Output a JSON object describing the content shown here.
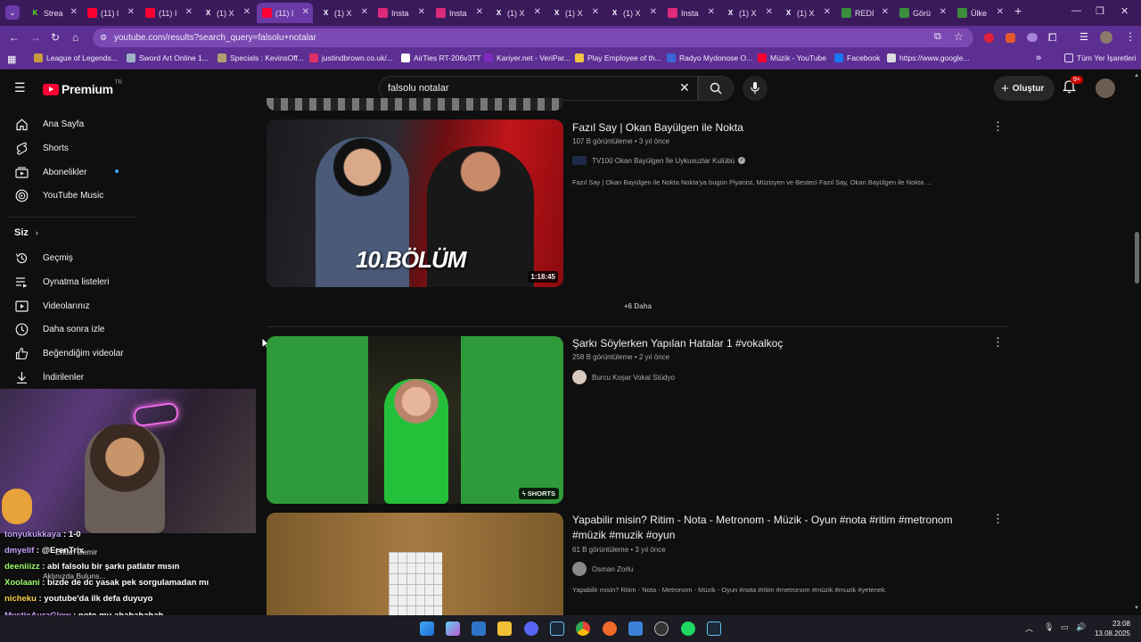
{
  "browser": {
    "tabs": [
      {
        "label": "Strea",
        "icon": "kick-icon",
        "color": "#53fc18"
      },
      {
        "label": "(11) I",
        "icon": "youtube-icon",
        "color": "#ff0033"
      },
      {
        "label": "(11) I",
        "icon": "youtube-icon",
        "color": "#ff0033"
      },
      {
        "label": "(1) X",
        "icon": "x-icon",
        "color": "#000000"
      },
      {
        "label": "(11) I",
        "icon": "youtube-icon",
        "color": "#ff0033",
        "active": true
      },
      {
        "label": "(1) X",
        "icon": "x-icon",
        "color": "#000000"
      },
      {
        "label": "Insta",
        "icon": "instagram-icon",
        "color": "#dd2a7b"
      },
      {
        "label": "Insta",
        "icon": "instagram-icon",
        "color": "#dd2a7b"
      },
      {
        "label": "(1) X",
        "icon": "x-icon",
        "color": "#000000"
      },
      {
        "label": "(1) X",
        "icon": "x-icon",
        "color": "#000000"
      },
      {
        "label": "(1) X",
        "icon": "x-icon",
        "color": "#000000"
      },
      {
        "label": "Insta",
        "icon": "instagram-icon",
        "color": "#dd2a7b"
      },
      {
        "label": "(1) X",
        "icon": "x-icon",
        "color": "#000000"
      },
      {
        "label": "(1) X",
        "icon": "x-icon",
        "color": "#000000"
      },
      {
        "label": "REDI",
        "icon": "globe-icon",
        "color": "#3b8f3b"
      },
      {
        "label": "Görü",
        "icon": "globe-icon",
        "color": "#3b8f3b"
      },
      {
        "label": "Ülke",
        "icon": "globe-icon",
        "color": "#3b8f3b"
      }
    ],
    "url": "youtube.com/results?search_query=falsolu+notalar",
    "bookmarks": [
      {
        "label": "League of Legends...",
        "color": "#c89b3c"
      },
      {
        "label": "Sword Art Online 1...",
        "color": "#9fb3c8"
      },
      {
        "label": "Specials : KevinsOff...",
        "color": "#b0a070"
      },
      {
        "label": "justindbrown.co.uk/...",
        "color": "#e0306a"
      },
      {
        "label": "AirTies RT-206v3TT",
        "color": "#ffffff"
      },
      {
        "label": "Kariyer.net - VeriPar...",
        "color": "#7b2cbf"
      },
      {
        "label": "Play Employee of th...",
        "color": "#f4c542"
      },
      {
        "label": "Radyo Mydonose O...",
        "color": "#3a66d6"
      },
      {
        "label": "Müzik - YouTube",
        "color": "#ff0033"
      },
      {
        "label": "Facebook",
        "color": "#1877f2"
      },
      {
        "label": "https://www.google...",
        "color": "#dddddd"
      }
    ],
    "all_bookmarks": "Tüm Yer İşaretleri"
  },
  "youtube": {
    "logo": "Premium",
    "logo_region": "TR",
    "search_value": "falsolu notalar",
    "create_label": "Oluştur",
    "notif_badge": "9+",
    "sidebar": {
      "main": [
        "Ana Sayfa",
        "Shorts",
        "Abonelikler",
        "YouTube Music"
      ],
      "you_header": "Siz",
      "you": [
        "Geçmiş",
        "Oynatma listeleri",
        "Videolarınız",
        "Daha sonra izle",
        "Beğendiğim videolar",
        "İndirilenler"
      ]
    },
    "results": [
      {
        "title": "Fazıl Say | Okan Bayülgen ile Nokta",
        "meta": "107 B görüntüleme • 3 yıl önce",
        "channel": "TV100 Okan Bayülgen İle Uykusuzlar Kulübü",
        "verified": true,
        "desc": "Fazıl Say | Okan Bayülgen ile Nokta Nokta'ya bugün Piyanist, Müzisyen ve Besteci Fazıl Say, Okan Bayülgen ile Nokta ...",
        "duration": "1:18:45",
        "thumb_text": "10.BÖLÜM"
      },
      {
        "title": "Şarkı Söylerken Yapılan Hatalar 1 #vokalkoç",
        "meta": "258 B görüntüleme • 2 yıl önce",
        "channel": "Burcu Koşar Vokal Stüdyo",
        "badge": "SHORTS"
      },
      {
        "title_line1": "Yapabilir misin? Ritim - Nota - Metronom - Müzik - Oyun #nota #ritim #metronom",
        "title_line2": "#müzik #muzik #oyun",
        "meta": "61 B görüntüleme • 3 yıl önce",
        "channel": "Osman Zorlu",
        "desc": "Yapabilir misin? Ritim - Nota - Metronom - Müzik - Oyun #nota #ritim #metronom #müzik #muzik #yetenek."
      }
    ],
    "more_label": "+6 Daha"
  },
  "chat": [
    {
      "user": "tonyukukkaya",
      "msg": "1-0",
      "color": "#c9a0ff"
    },
    {
      "user": "dmyelif",
      "msg": "@ErenTrix",
      "color": "#c9a0ff"
    },
    {
      "user": "deeniiizz",
      "msg": "abi falsolu bir şarkı patlatır mısın",
      "color": "#9cff6b"
    },
    {
      "user": "Xoolaani",
      "msg": "bizde de dc yasak pek sorgulamadan mı",
      "color": "#9cff6b"
    },
    {
      "user": "nicheku",
      "msg": "youtube'da ilk defa duyuyo",
      "color": "#ffd24d"
    },
    {
      "user": "MysticAuraGlow",
      "msg": "noto mu ahahahahah",
      "color": "#c9a0ff"
    }
  ],
  "overlay_texts": [
    "Erkan Demir",
    "Aklınızda Buluns..."
  ],
  "taskbar": {
    "time": "23:08",
    "date": "13.08.2025"
  }
}
